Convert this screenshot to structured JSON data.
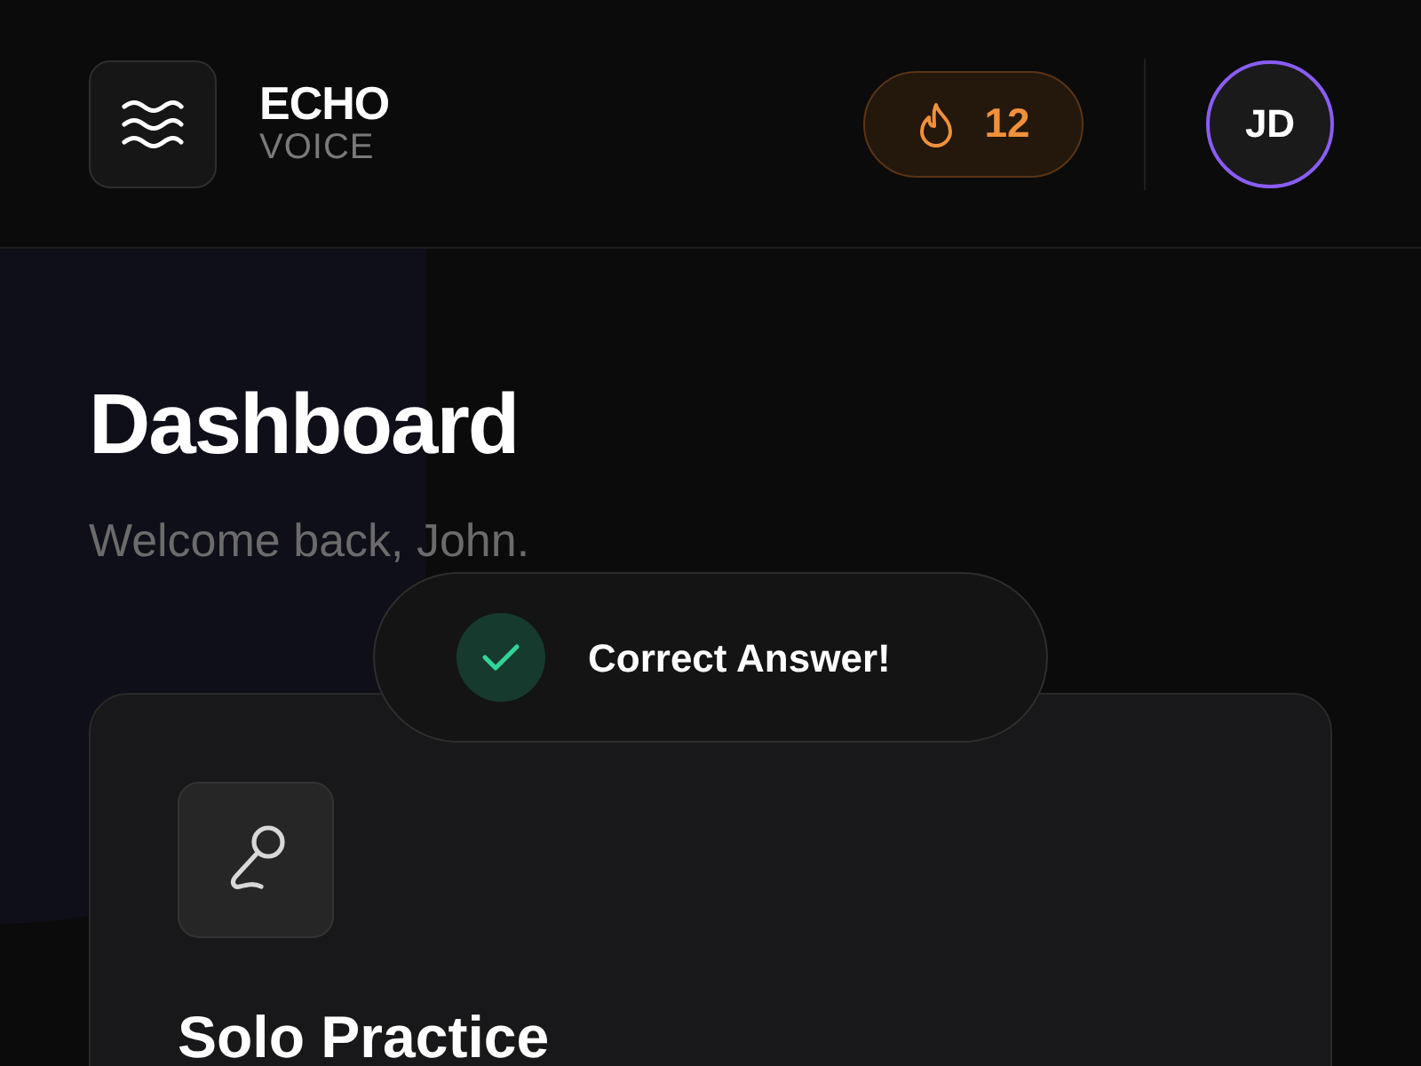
{
  "header": {
    "brand": "ECHO",
    "tagline": "VOICE",
    "streak": "12",
    "avatar_initials": "JD"
  },
  "page": {
    "title": "Dashboard",
    "subtitle": "Welcome back, John."
  },
  "toast": {
    "message": "Correct Answer!"
  },
  "cards": [
    {
      "title": "Solo Practice"
    }
  ]
}
